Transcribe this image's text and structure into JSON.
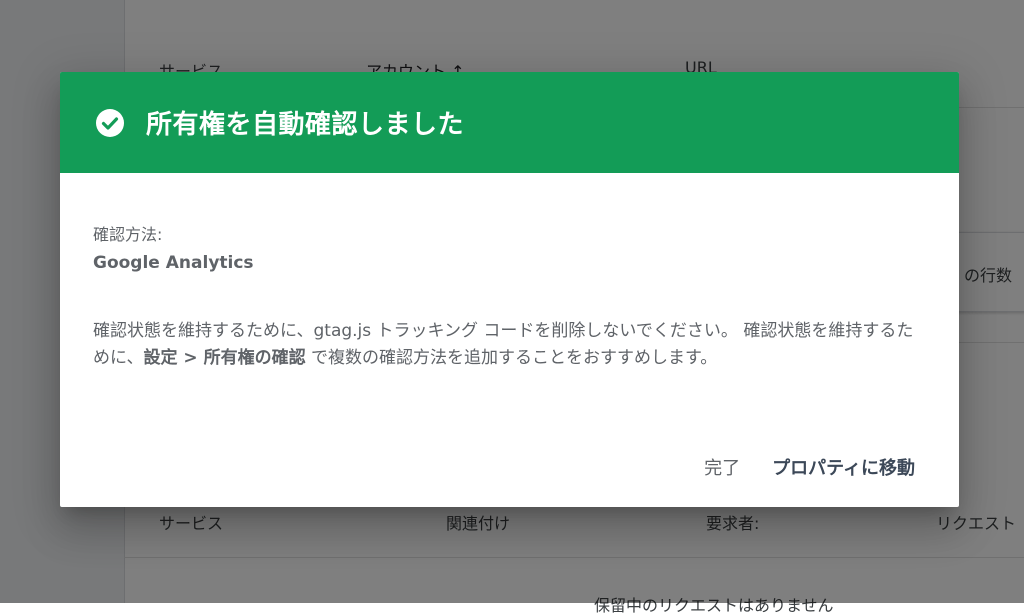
{
  "background": {
    "table1_headers": [
      "サービス",
      "アカウント ↑",
      "URL"
    ],
    "right_snippet": "の行数",
    "table2_headers": [
      "サービス",
      "関連付け",
      "要求者:",
      "リクエスト"
    ],
    "bottom_snippet": "保留中のリクエストはありません"
  },
  "dialog": {
    "title": "所有権を自動確認しました",
    "method_label": "確認方法:",
    "method_value": "Google Analytics",
    "desc_part1": "確認状態を維持するために、gtag.js トラッキング コードを削除しないでください。 確認状態を維持するために、",
    "desc_bold": "設定 > 所有権の確認",
    "desc_part2": " で複数の確認方法を追加することをおすすめします。",
    "done_label": "完了",
    "go_label": "プロパティに移動"
  },
  "colors": {
    "header_green": "#139c57",
    "body_text": "#5f6368"
  },
  "icons": {
    "header": "check-circle-icon"
  }
}
